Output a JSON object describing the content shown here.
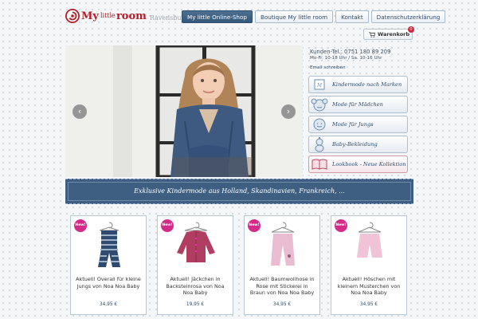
{
  "logo": {
    "my": "My",
    "little": "little",
    "room": "room",
    "city": "Ravensburg"
  },
  "nav": {
    "items": [
      {
        "label": "My little Online-Shop"
      },
      {
        "label": "Boutique My little room"
      },
      {
        "label": "Kontakt"
      },
      {
        "label": "Datenschutzerklärung"
      }
    ]
  },
  "cart": {
    "label": "Warenkorb",
    "count": "0"
  },
  "slider": {
    "prev": "‹",
    "next": "›"
  },
  "contact": {
    "tel": "Kunden-Tel.: 0751 180 89 209",
    "hours": "Mo-Fr. 10-18 Uhr / Sa. 10-16 Uhr",
    "email": "Email schreiben"
  },
  "sidebar": {
    "items": [
      {
        "label": "Kindermode nach Marken",
        "icon": "tag-icon"
      },
      {
        "label": "Mode für Mädchen",
        "icon": "girl-face-icon"
      },
      {
        "label": "Mode für Jungs",
        "icon": "boy-face-icon"
      },
      {
        "label": "Baby-Bekleidung",
        "icon": "baby-icon"
      },
      {
        "label": "Lookbook - Neue Kollektion",
        "icon": "book-icon"
      }
    ]
  },
  "banner": {
    "text": "Exklusive Kindermode aus Holland, Skandinavien, Frankreich, ..."
  },
  "products": [
    {
      "badge": "New!",
      "name": "Aktuell! Overall für kleine Jungs von Noa Noa Baby",
      "price": "34,95 €"
    },
    {
      "badge": "New!",
      "name": "Aktuell! Jäckchen in Backsteinrosa von Noa Noa Baby",
      "price": "19,95 €"
    },
    {
      "badge": "New!",
      "name": "Aktuell! Baumwollhose in Rose mit Stickerei in Braun von Noa Noa Baby",
      "price": "34,95 €"
    },
    {
      "badge": "New!",
      "name": "Aktuell! Höschen mit kleinem Musterchen von Noa Noa Baby",
      "price": "34,95 €"
    }
  ],
  "colors": {
    "navy": "#35577a",
    "brand_red": "#b3202a",
    "badge_pink": "#d42b8a"
  }
}
